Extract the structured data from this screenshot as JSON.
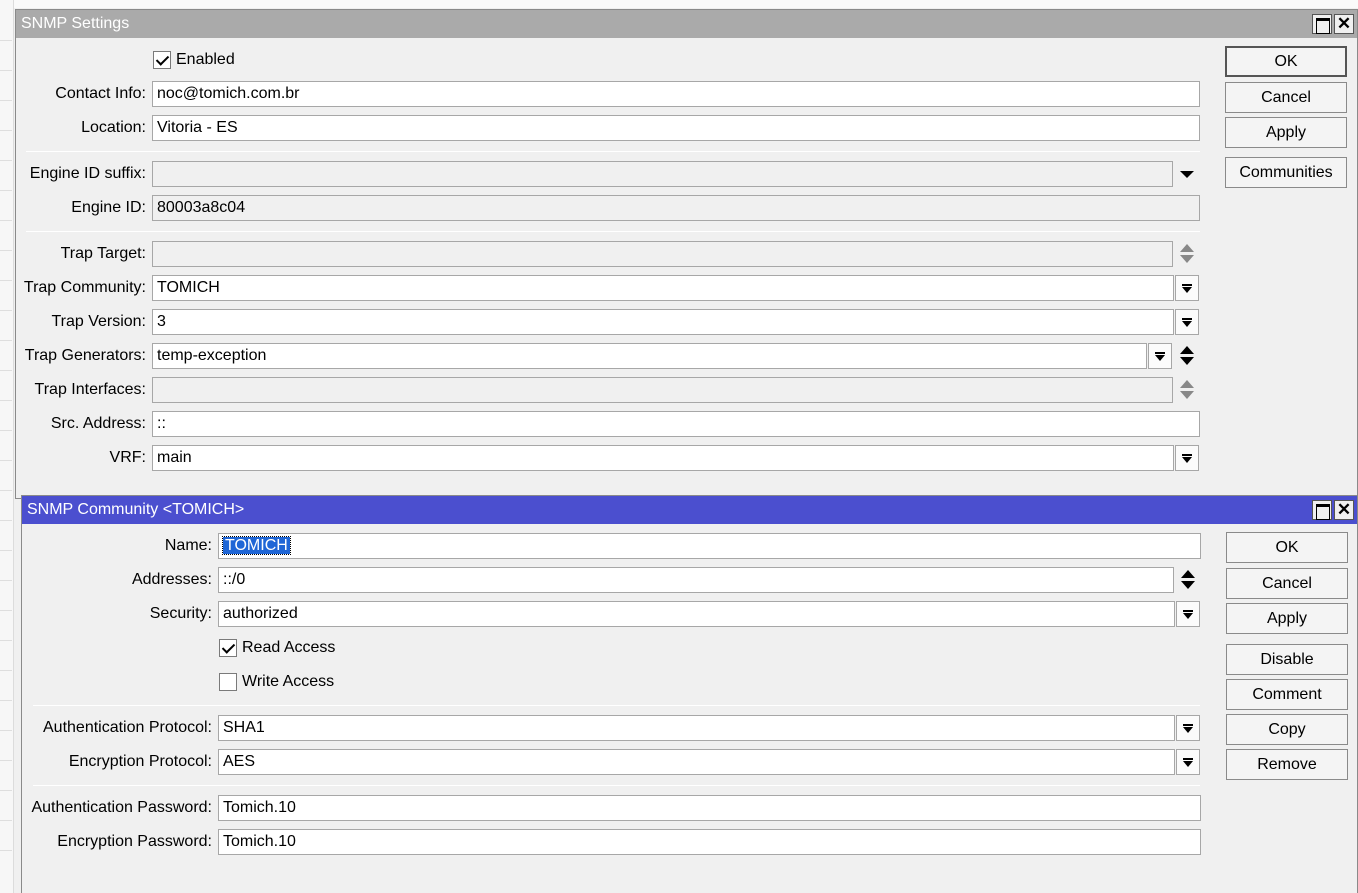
{
  "settings_window": {
    "title": "SNMP Settings",
    "enabled_label": "Enabled",
    "enabled": true,
    "fields": {
      "contact_info": {
        "label": "Contact Info:",
        "value": "noc@tomich.com.br"
      },
      "location": {
        "label": "Location:",
        "value": "Vitoria - ES"
      },
      "engine_id_suffix": {
        "label": "Engine ID suffix:",
        "value": ""
      },
      "engine_id": {
        "label": "Engine ID:",
        "value": "80003a8c04"
      },
      "trap_target": {
        "label": "Trap Target:",
        "value": ""
      },
      "trap_community": {
        "label": "Trap Community:",
        "value": "TOMICH"
      },
      "trap_version": {
        "label": "Trap Version:",
        "value": "3"
      },
      "trap_generators": {
        "label": "Trap Generators:",
        "value": "temp-exception"
      },
      "trap_interfaces": {
        "label": "Trap Interfaces:",
        "value": ""
      },
      "src_address": {
        "label": "Src. Address:",
        "value": "::"
      },
      "vrf": {
        "label": "VRF:",
        "value": "main"
      }
    },
    "buttons": {
      "ok": "OK",
      "cancel": "Cancel",
      "apply": "Apply",
      "communities": "Communities"
    }
  },
  "community_window": {
    "title": "SNMP Community <TOMICH>",
    "fields": {
      "name": {
        "label": "Name:",
        "value": "TOMICH"
      },
      "addresses": {
        "label": "Addresses:",
        "value": "::/0"
      },
      "security": {
        "label": "Security:",
        "value": "authorized"
      },
      "auth_protocol": {
        "label": "Authentication Protocol:",
        "value": "SHA1"
      },
      "enc_protocol": {
        "label": "Encryption Protocol:",
        "value": "AES"
      },
      "auth_password": {
        "label": "Authentication Password:",
        "value": "Tomich.10"
      },
      "enc_password": {
        "label": "Encryption Password:",
        "value": "Tomich.10"
      }
    },
    "read_access_label": "Read Access",
    "read_access": true,
    "write_access_label": "Write Access",
    "write_access": false,
    "buttons": {
      "ok": "OK",
      "cancel": "Cancel",
      "apply": "Apply",
      "disable": "Disable",
      "comment": "Comment",
      "copy": "Copy",
      "remove": "Remove"
    }
  },
  "window_controls": {
    "maximize": "maximize-icon",
    "close": "✕"
  },
  "colors": {
    "active_titlebar": "#4b4fcf",
    "inactive_titlebar": "#aaaaaa",
    "selection": "#1f66d6"
  }
}
